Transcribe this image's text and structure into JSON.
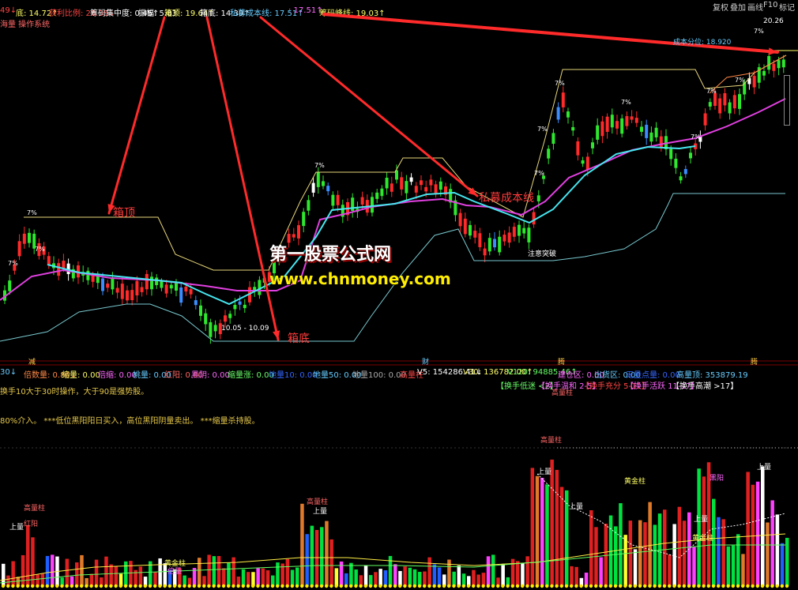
{
  "topbar": {
    "items": [
      {
        "key": "a",
        "text": "49↓",
        "color": "#ff4444"
      },
      {
        "key": "b",
        "text": "底: 14.72↑",
        "color": "#ffff66"
      },
      {
        "key": "c",
        "text": "获利比例: 20.35↓",
        "color": "#ff4444"
      },
      {
        "key": "d",
        "text": "筹码集中度: 0.45↑",
        "color": "#ffffff"
      },
      {
        "key": "e",
        "text": "振幅: 5.83",
        "color": "#ffffff"
      },
      {
        "key": "f",
        "text": "箱顶: 19.64↑",
        "color": "#ffff66"
      },
      {
        "key": "g",
        "text": "箱底: 14.39↑",
        "color": "#ffffff"
      },
      {
        "key": "h",
        "text": "私募成本线: 17.51↑",
        "color": "#66ccff"
      },
      {
        "key": "i",
        "text": ": 17.51↑",
        "color": "#ff66ff"
      },
      {
        "key": "j",
        "text": "筹码峰线: 19.03↑",
        "color": "#ffff66"
      }
    ],
    "subtitle": "海量 操作系统"
  },
  "system_buttons": [
    "复权",
    "叠加",
    "画线",
    "F10",
    "标记"
  ],
  "price_labels": {
    "high_value": "20.26",
    "cost_line": "成本分位: 18.920",
    "low_range": "10.05 - 10.09",
    "signal": "注意突破"
  },
  "annotations": {
    "box_top": "箱顶",
    "box_bottom": "箱底",
    "private_cost": "私募成本线"
  },
  "watermark": {
    "line1": "第一股票公式网",
    "line2": "www.chnmoney.com"
  },
  "date_markers": [
    {
      "text": "减",
      "color": "#ffcc44"
    },
    {
      "text": "财",
      "color": "#66ccff"
    },
    {
      "text": "腾",
      "color": "#ffcc44"
    },
    {
      "text": "腾",
      "color": "#ffcc44"
    }
  ],
  "volume_bar": [
    {
      "text": "30↓",
      "color": "#66ccff"
    },
    {
      "text": "倍数量: 0.80↓",
      "color": "#ff8844"
    },
    {
      "text": "缩量: 0.00",
      "color": "#ffff66"
    },
    {
      "text": "倍缩: 0.00",
      "color": "#ff66ff"
    },
    {
      "text": "桃量: 0.00",
      "color": "#66ccff"
    },
    {
      "text": "红阳: 0.00",
      "color": "#ff6666"
    },
    {
      "text": "黑阴: 0.00",
      "color": "#ff66ff"
    },
    {
      "text": "缩量涨: 0.00",
      "color": "#66ff66"
    },
    {
      "text": "地量10: 0.00",
      "color": "#3366ff"
    },
    {
      "text": "地量50: 0.00",
      "color": "#66ccff"
    },
    {
      "text": "地量100: 0.00",
      "color": "#aaaaaa"
    },
    {
      "text": "高量柱",
      "color": "#ff4444"
    },
    {
      "text": "V5: 154286.41↓",
      "color": "#ffffff"
    },
    {
      "text": "V30: 136782.00↑",
      "color": "#ffff66"
    },
    {
      "text": "V120: 94885.46↑",
      "color": "#66ff66"
    },
    {
      "text": "建仓区: 0.00",
      "color": "#ff66ff"
    },
    {
      "text": "出货区: 0.00",
      "color": "#66ccff"
    },
    {
      "text": "无量点量: 0.00",
      "color": "#3366ff"
    },
    {
      "text": "高量顶: 353879.19",
      "color": "#66ccff"
    }
  ],
  "turnover_legend": [
    {
      "text": "【换手低迷 <2】",
      "color": "#66ff66"
    },
    {
      "text": "【换手温和 2-5】",
      "color": "#ff66ff"
    },
    {
      "text": "【换手充分 5-11】",
      "color": "#ff4444"
    },
    {
      "text": "【换手活跃 11-17】",
      "color": "#ff66ff"
    },
    {
      "text": "【换手高潮 >17】",
      "color": "#ffffff"
    }
  ],
  "notes": {
    "line1": "换手10大于30时操作，大于90是强势股。",
    "line2": "80%介入。  ***低位黑阳阳日买入，高位黑阳阴量卖出。  ***缩量杀持股。"
  },
  "volume_labels": [
    {
      "text": "高量柱",
      "color": "#ff6666"
    },
    {
      "text": "高量柱",
      "color": "#ff6666"
    },
    {
      "text": "高量柱",
      "color": "#ff6666"
    },
    {
      "text": "高量柱",
      "color": "#ff6666"
    },
    {
      "text": "上量",
      "color": "#ffffff"
    },
    {
      "text": "上量",
      "color": "#ffffff"
    },
    {
      "text": "上量",
      "color": "#ffffff"
    },
    {
      "text": "上量",
      "color": "#ffffff"
    },
    {
      "text": "上量",
      "color": "#ffffff"
    },
    {
      "text": "上量",
      "color": "#ffffff"
    },
    {
      "text": "黄金柱",
      "color": "#ffff66"
    },
    {
      "text": "黄金柱",
      "color": "#ffff66"
    },
    {
      "text": "黄金柱",
      "color": "#ffff66"
    },
    {
      "text": "倍量",
      "color": "#ff66ff"
    },
    {
      "text": "黑阳",
      "color": "#ff66ff"
    },
    {
      "text": "红阳",
      "color": "#ff6666"
    }
  ],
  "colors": {
    "up": "#ff2a2a",
    "down": "#2ee82e",
    "ma_cyan": "#46e6f0",
    "ma_magenta": "#e040e0",
    "box_line": "#e8d67a",
    "lower_band": "#79c9cf",
    "arrow": "#ff2a2a"
  }
}
